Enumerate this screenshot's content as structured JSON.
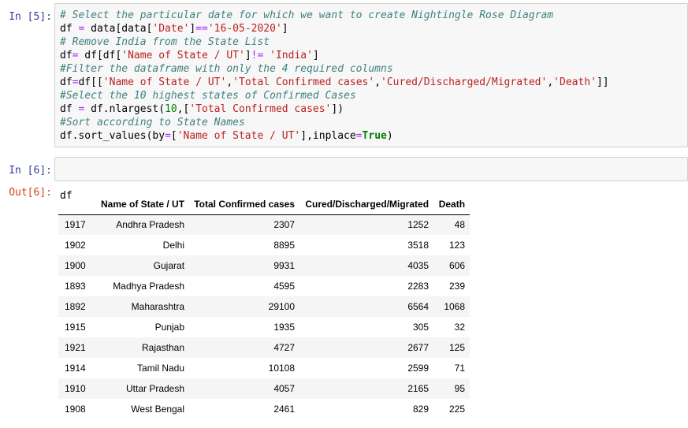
{
  "cell5": {
    "prompt": "In [5]:",
    "lines": [
      [
        {
          "t": "# Select the particular date for which we want to create Nightingle Rose Diagram",
          "c": "c"
        }
      ],
      [
        {
          "t": "df "
        },
        {
          "t": "=",
          "c": "o"
        },
        {
          "t": " data[data["
        },
        {
          "t": "'Date'",
          "c": "s"
        },
        {
          "t": "]"
        },
        {
          "t": "==",
          "c": "o"
        },
        {
          "t": "'16-05-2020'",
          "c": "s"
        },
        {
          "t": "]"
        }
      ],
      [
        {
          "t": "# Remove India from the State List",
          "c": "c"
        }
      ],
      [
        {
          "t": "df"
        },
        {
          "t": "=",
          "c": "o"
        },
        {
          "t": " df[df["
        },
        {
          "t": "'Name of State / UT'",
          "c": "s"
        },
        {
          "t": "]"
        },
        {
          "t": "!=",
          "c": "o"
        },
        {
          "t": " "
        },
        {
          "t": "'India'",
          "c": "s"
        },
        {
          "t": "]"
        }
      ],
      [
        {
          "t": "#Filter the dataframe with only the 4 required columns",
          "c": "c"
        }
      ],
      [
        {
          "t": "df"
        },
        {
          "t": "=",
          "c": "o"
        },
        {
          "t": "df[["
        },
        {
          "t": "'Name of State / UT'",
          "c": "s"
        },
        {
          "t": ","
        },
        {
          "t": "'Total Confirmed cases'",
          "c": "s"
        },
        {
          "t": ","
        },
        {
          "t": "'Cured/Discharged/Migrated'",
          "c": "s"
        },
        {
          "t": ","
        },
        {
          "t": "'Death'",
          "c": "s"
        },
        {
          "t": "]]"
        }
      ],
      [
        {
          "t": "#Select the 10 highest states of Confirmed Cases",
          "c": "c"
        }
      ],
      [
        {
          "t": "df "
        },
        {
          "t": "=",
          "c": "o"
        },
        {
          "t": " df.nlargest("
        },
        {
          "t": "10",
          "c": "n"
        },
        {
          "t": ",["
        },
        {
          "t": "'Total Confirmed cases'",
          "c": "s"
        },
        {
          "t": "])"
        }
      ],
      [
        {
          "t": "#Sort according to State Names",
          "c": "c"
        }
      ],
      [
        {
          "t": "df.sort_values(by"
        },
        {
          "t": "=",
          "c": "o"
        },
        {
          "t": "["
        },
        {
          "t": "'Name of State / UT'",
          "c": "s"
        },
        {
          "t": "],inplace"
        },
        {
          "t": "=",
          "c": "o"
        },
        {
          "t": "True",
          "c": "kw"
        },
        {
          "t": ")"
        }
      ]
    ]
  },
  "cell6": {
    "prompt": "In [6]:",
    "code": "df",
    "out_prompt": "Out[6]:",
    "table": {
      "columns": [
        "",
        "Name of State / UT",
        "Total Confirmed cases",
        "Cured/Discharged/Migrated",
        "Death"
      ],
      "rows": [
        [
          "1917",
          "Andhra Pradesh",
          "2307",
          "1252",
          "48"
        ],
        [
          "1902",
          "Delhi",
          "8895",
          "3518",
          "123"
        ],
        [
          "1900",
          "Gujarat",
          "9931",
          "4035",
          "606"
        ],
        [
          "1893",
          "Madhya Pradesh",
          "4595",
          "2283",
          "239"
        ],
        [
          "1892",
          "Maharashtra",
          "29100",
          "6564",
          "1068"
        ],
        [
          "1915",
          "Punjab",
          "1935",
          "305",
          "32"
        ],
        [
          "1921",
          "Rajasthan",
          "4727",
          "2677",
          "125"
        ],
        [
          "1914",
          "Tamil Nadu",
          "10108",
          "2599",
          "71"
        ],
        [
          "1910",
          "Uttar Pradesh",
          "4057",
          "2165",
          "95"
        ],
        [
          "1908",
          "West Bengal",
          "2461",
          "829",
          "225"
        ]
      ]
    }
  }
}
